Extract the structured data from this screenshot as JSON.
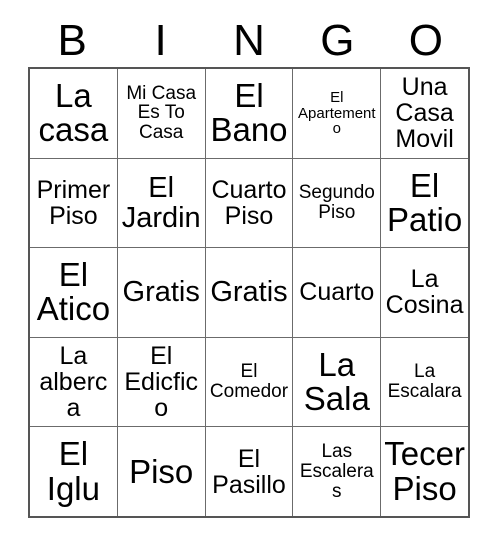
{
  "card": {
    "headers": [
      "B",
      "I",
      "N",
      "G",
      "O"
    ],
    "rows": [
      [
        {
          "text": "La casa",
          "size": "fs-xl"
        },
        {
          "text": "Mi Casa Es To Casa",
          "size": "fs-sm"
        },
        {
          "text": "El Bano",
          "size": "fs-xl"
        },
        {
          "text": "El Apartemento",
          "size": "fs-xs"
        },
        {
          "text": "Una Casa Movil",
          "size": "fs-md"
        }
      ],
      [
        {
          "text": "Primer Piso",
          "size": "fs-md"
        },
        {
          "text": "El Jardin",
          "size": "fs-lg"
        },
        {
          "text": "Cuarto Piso",
          "size": "fs-md"
        },
        {
          "text": "Segundo Piso",
          "size": "fs-sm"
        },
        {
          "text": "El Patio",
          "size": "fs-xl"
        }
      ],
      [
        {
          "text": "El Atico",
          "size": "fs-xl"
        },
        {
          "text": "Gratis",
          "size": "fs-lg"
        },
        {
          "text": "Gratis",
          "size": "fs-lg"
        },
        {
          "text": "Cuarto",
          "size": "fs-md"
        },
        {
          "text": "La Cosina",
          "size": "fs-md"
        }
      ],
      [
        {
          "text": "La alberca",
          "size": "fs-md"
        },
        {
          "text": "El Edicfico",
          "size": "fs-md"
        },
        {
          "text": "El Comedor",
          "size": "fs-sm"
        },
        {
          "text": "La Sala",
          "size": "fs-xl"
        },
        {
          "text": "La Escalara",
          "size": "fs-sm"
        }
      ],
      [
        {
          "text": "El Iglu",
          "size": "fs-xl"
        },
        {
          "text": "Piso",
          "size": "fs-xl"
        },
        {
          "text": "El Pasillo",
          "size": "fs-md"
        },
        {
          "text": "Las Escaleras",
          "size": "fs-sm"
        },
        {
          "text": "Tecer Piso",
          "size": "fs-xl"
        }
      ]
    ]
  }
}
